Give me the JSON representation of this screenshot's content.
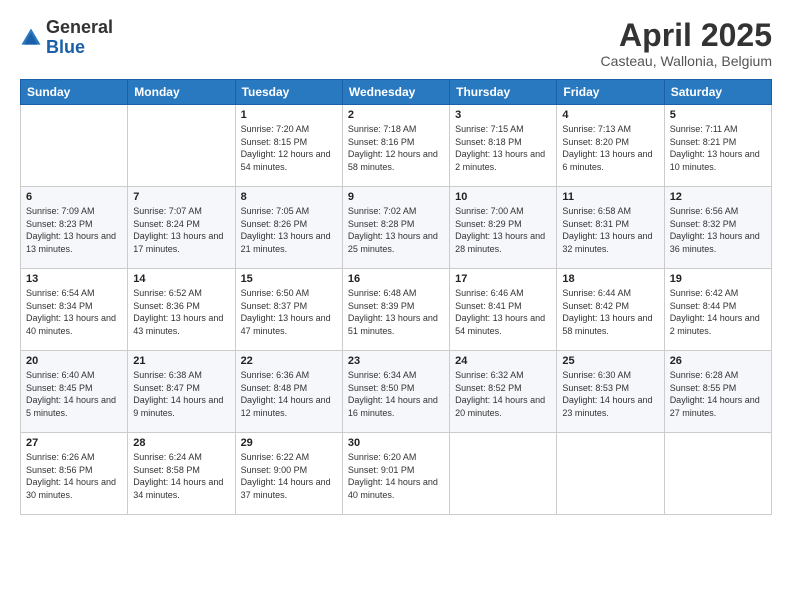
{
  "logo": {
    "general": "General",
    "blue": "Blue"
  },
  "header": {
    "month": "April 2025",
    "location": "Casteau, Wallonia, Belgium"
  },
  "weekdays": [
    "Sunday",
    "Monday",
    "Tuesday",
    "Wednesday",
    "Thursday",
    "Friday",
    "Saturday"
  ],
  "weeks": [
    [
      {
        "day": "",
        "sunrise": "",
        "sunset": "",
        "daylight": ""
      },
      {
        "day": "",
        "sunrise": "",
        "sunset": "",
        "daylight": ""
      },
      {
        "day": "1",
        "sunrise": "Sunrise: 7:20 AM",
        "sunset": "Sunset: 8:15 PM",
        "daylight": "Daylight: 12 hours and 54 minutes."
      },
      {
        "day": "2",
        "sunrise": "Sunrise: 7:18 AM",
        "sunset": "Sunset: 8:16 PM",
        "daylight": "Daylight: 12 hours and 58 minutes."
      },
      {
        "day": "3",
        "sunrise": "Sunrise: 7:15 AM",
        "sunset": "Sunset: 8:18 PM",
        "daylight": "Daylight: 13 hours and 2 minutes."
      },
      {
        "day": "4",
        "sunrise": "Sunrise: 7:13 AM",
        "sunset": "Sunset: 8:20 PM",
        "daylight": "Daylight: 13 hours and 6 minutes."
      },
      {
        "day": "5",
        "sunrise": "Sunrise: 7:11 AM",
        "sunset": "Sunset: 8:21 PM",
        "daylight": "Daylight: 13 hours and 10 minutes."
      }
    ],
    [
      {
        "day": "6",
        "sunrise": "Sunrise: 7:09 AM",
        "sunset": "Sunset: 8:23 PM",
        "daylight": "Daylight: 13 hours and 13 minutes."
      },
      {
        "day": "7",
        "sunrise": "Sunrise: 7:07 AM",
        "sunset": "Sunset: 8:24 PM",
        "daylight": "Daylight: 13 hours and 17 minutes."
      },
      {
        "day": "8",
        "sunrise": "Sunrise: 7:05 AM",
        "sunset": "Sunset: 8:26 PM",
        "daylight": "Daylight: 13 hours and 21 minutes."
      },
      {
        "day": "9",
        "sunrise": "Sunrise: 7:02 AM",
        "sunset": "Sunset: 8:28 PM",
        "daylight": "Daylight: 13 hours and 25 minutes."
      },
      {
        "day": "10",
        "sunrise": "Sunrise: 7:00 AM",
        "sunset": "Sunset: 8:29 PM",
        "daylight": "Daylight: 13 hours and 28 minutes."
      },
      {
        "day": "11",
        "sunrise": "Sunrise: 6:58 AM",
        "sunset": "Sunset: 8:31 PM",
        "daylight": "Daylight: 13 hours and 32 minutes."
      },
      {
        "day": "12",
        "sunrise": "Sunrise: 6:56 AM",
        "sunset": "Sunset: 8:32 PM",
        "daylight": "Daylight: 13 hours and 36 minutes."
      }
    ],
    [
      {
        "day": "13",
        "sunrise": "Sunrise: 6:54 AM",
        "sunset": "Sunset: 8:34 PM",
        "daylight": "Daylight: 13 hours and 40 minutes."
      },
      {
        "day": "14",
        "sunrise": "Sunrise: 6:52 AM",
        "sunset": "Sunset: 8:36 PM",
        "daylight": "Daylight: 13 hours and 43 minutes."
      },
      {
        "day": "15",
        "sunrise": "Sunrise: 6:50 AM",
        "sunset": "Sunset: 8:37 PM",
        "daylight": "Daylight: 13 hours and 47 minutes."
      },
      {
        "day": "16",
        "sunrise": "Sunrise: 6:48 AM",
        "sunset": "Sunset: 8:39 PM",
        "daylight": "Daylight: 13 hours and 51 minutes."
      },
      {
        "day": "17",
        "sunrise": "Sunrise: 6:46 AM",
        "sunset": "Sunset: 8:41 PM",
        "daylight": "Daylight: 13 hours and 54 minutes."
      },
      {
        "day": "18",
        "sunrise": "Sunrise: 6:44 AM",
        "sunset": "Sunset: 8:42 PM",
        "daylight": "Daylight: 13 hours and 58 minutes."
      },
      {
        "day": "19",
        "sunrise": "Sunrise: 6:42 AM",
        "sunset": "Sunset: 8:44 PM",
        "daylight": "Daylight: 14 hours and 2 minutes."
      }
    ],
    [
      {
        "day": "20",
        "sunrise": "Sunrise: 6:40 AM",
        "sunset": "Sunset: 8:45 PM",
        "daylight": "Daylight: 14 hours and 5 minutes."
      },
      {
        "day": "21",
        "sunrise": "Sunrise: 6:38 AM",
        "sunset": "Sunset: 8:47 PM",
        "daylight": "Daylight: 14 hours and 9 minutes."
      },
      {
        "day": "22",
        "sunrise": "Sunrise: 6:36 AM",
        "sunset": "Sunset: 8:48 PM",
        "daylight": "Daylight: 14 hours and 12 minutes."
      },
      {
        "day": "23",
        "sunrise": "Sunrise: 6:34 AM",
        "sunset": "Sunset: 8:50 PM",
        "daylight": "Daylight: 14 hours and 16 minutes."
      },
      {
        "day": "24",
        "sunrise": "Sunrise: 6:32 AM",
        "sunset": "Sunset: 8:52 PM",
        "daylight": "Daylight: 14 hours and 20 minutes."
      },
      {
        "day": "25",
        "sunrise": "Sunrise: 6:30 AM",
        "sunset": "Sunset: 8:53 PM",
        "daylight": "Daylight: 14 hours and 23 minutes."
      },
      {
        "day": "26",
        "sunrise": "Sunrise: 6:28 AM",
        "sunset": "Sunset: 8:55 PM",
        "daylight": "Daylight: 14 hours and 27 minutes."
      }
    ],
    [
      {
        "day": "27",
        "sunrise": "Sunrise: 6:26 AM",
        "sunset": "Sunset: 8:56 PM",
        "daylight": "Daylight: 14 hours and 30 minutes."
      },
      {
        "day": "28",
        "sunrise": "Sunrise: 6:24 AM",
        "sunset": "Sunset: 8:58 PM",
        "daylight": "Daylight: 14 hours and 34 minutes."
      },
      {
        "day": "29",
        "sunrise": "Sunrise: 6:22 AM",
        "sunset": "Sunset: 9:00 PM",
        "daylight": "Daylight: 14 hours and 37 minutes."
      },
      {
        "day": "30",
        "sunrise": "Sunrise: 6:20 AM",
        "sunset": "Sunset: 9:01 PM",
        "daylight": "Daylight: 14 hours and 40 minutes."
      },
      {
        "day": "",
        "sunrise": "",
        "sunset": "",
        "daylight": ""
      },
      {
        "day": "",
        "sunrise": "",
        "sunset": "",
        "daylight": ""
      },
      {
        "day": "",
        "sunrise": "",
        "sunset": "",
        "daylight": ""
      }
    ]
  ]
}
